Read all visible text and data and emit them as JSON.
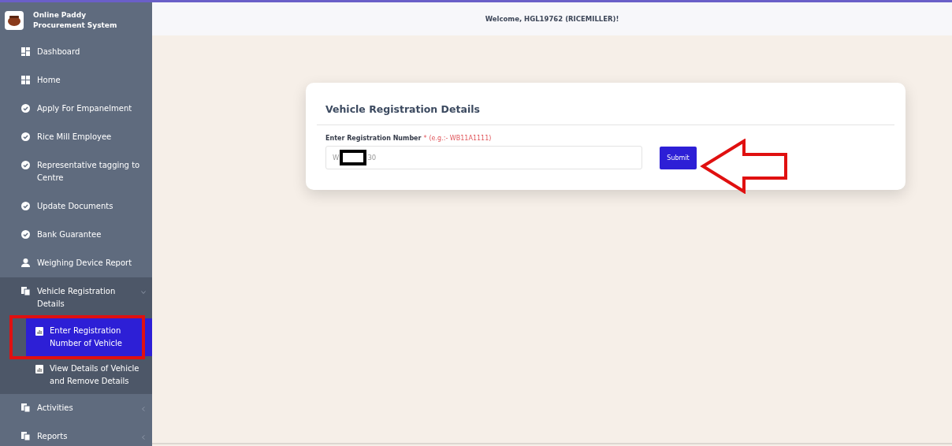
{
  "brand": {
    "title": "Online Paddy Procurement System"
  },
  "header": {
    "welcome": "Welcome, HGL19762 (RICEMILLER)!"
  },
  "sidebar": {
    "items": [
      {
        "kind": "dashboard",
        "label": "Dashboard"
      },
      {
        "kind": "grid",
        "label": "Home"
      },
      {
        "kind": "check",
        "label": "Apply For Empanelment"
      },
      {
        "kind": "check",
        "label": "Rice Mill Employee"
      },
      {
        "kind": "check",
        "label": "Representative tagging to Centre"
      },
      {
        "kind": "check",
        "label": "Update Documents"
      },
      {
        "kind": "check",
        "label": "Bank Guarantee"
      },
      {
        "kind": "person",
        "label": "Weighing Device Report"
      },
      {
        "kind": "group",
        "label": "Vehicle Registration Details",
        "expanded": true,
        "children": [
          {
            "label": "Enter Registration Number of Vehicle",
            "selected": true
          },
          {
            "label": "View Details of Vehicle and Remove Details",
            "selected": false
          }
        ]
      },
      {
        "kind": "group",
        "label": "Activities",
        "expanded": false
      },
      {
        "kind": "group",
        "label": "Reports",
        "expanded": false
      }
    ]
  },
  "card": {
    "title": "Vehicle Registration Details",
    "field": {
      "label": "Enter Registration Number",
      "required_mark": "*",
      "hint": "(e.g.:- WB11A1111)",
      "value_start": "W",
      "value_end": "30"
    },
    "submit": "Submit"
  }
}
